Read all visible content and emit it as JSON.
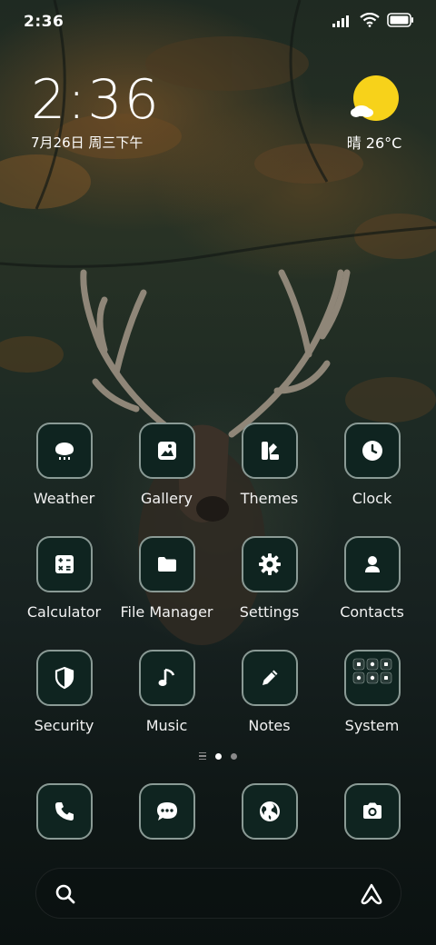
{
  "status_bar": {
    "time": "2:36",
    "icons": [
      "signal-icon",
      "wifi-icon",
      "battery-icon"
    ]
  },
  "clock_widget": {
    "time": "2:36",
    "date": "7月26日 周三下午"
  },
  "weather_widget": {
    "icon": "sun-cloud-icon",
    "text": "晴 26°C"
  },
  "apps": [
    {
      "label": "Weather",
      "icon": "weather-cloud-icon"
    },
    {
      "label": "Gallery",
      "icon": "gallery-icon"
    },
    {
      "label": "Themes",
      "icon": "themes-icon"
    },
    {
      "label": "Clock",
      "icon": "clock-icon"
    },
    {
      "label": "Calculator",
      "icon": "calculator-icon"
    },
    {
      "label": "File Manager",
      "icon": "folder-icon"
    },
    {
      "label": "Settings",
      "icon": "gear-icon"
    },
    {
      "label": "Contacts",
      "icon": "contact-icon"
    },
    {
      "label": "Security",
      "icon": "shield-icon"
    },
    {
      "label": "Music",
      "icon": "music-note-icon"
    },
    {
      "label": "Notes",
      "icon": "pencil-icon"
    },
    {
      "label": "System",
      "icon": "folder-grid-icon"
    }
  ],
  "page_indicator": {
    "pages": 2,
    "active": 1
  },
  "dock": [
    {
      "icon": "phone-icon"
    },
    {
      "icon": "message-icon"
    },
    {
      "icon": "browser-globe-icon"
    },
    {
      "icon": "camera-icon"
    }
  ],
  "search_bar": {
    "icons": [
      "search-icon",
      "assistant-icon"
    ]
  },
  "colors": {
    "icon_fill": "#0f2420",
    "icon_border": "#8a9a95",
    "sun": "#f7d21a"
  }
}
